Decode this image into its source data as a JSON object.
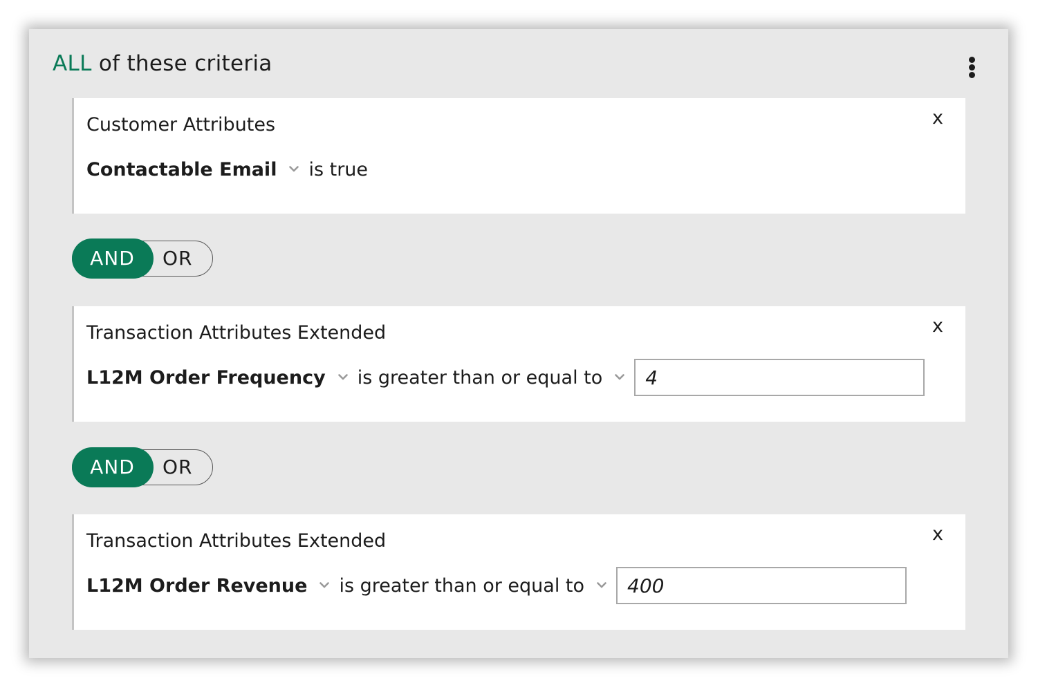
{
  "header": {
    "match_word": "ALL",
    "suffix": "of these criteria",
    "menu_icon": "more-vertical-icon"
  },
  "colors": {
    "accent": "#0a7a57",
    "panel_bg": "#e8e8e8",
    "card_bg": "#ffffff"
  },
  "criteria": [
    {
      "category": "Customer Attributes",
      "close": "x",
      "field": "Contactable Email",
      "operator": "is true"
    },
    {
      "category": "Transaction Attributes Extended",
      "close": "x",
      "field": "L12M Order Frequency",
      "operator": "is greater than or equal to",
      "value": "4"
    },
    {
      "category": "Transaction Attributes Extended",
      "close": "x",
      "field": "L12M Order Revenue",
      "operator": "is greater than or equal to",
      "value": "400"
    }
  ],
  "connectors": [
    {
      "and_label": "AND",
      "or_label": "OR",
      "selected": "AND"
    },
    {
      "and_label": "AND",
      "or_label": "OR",
      "selected": "AND"
    }
  ]
}
